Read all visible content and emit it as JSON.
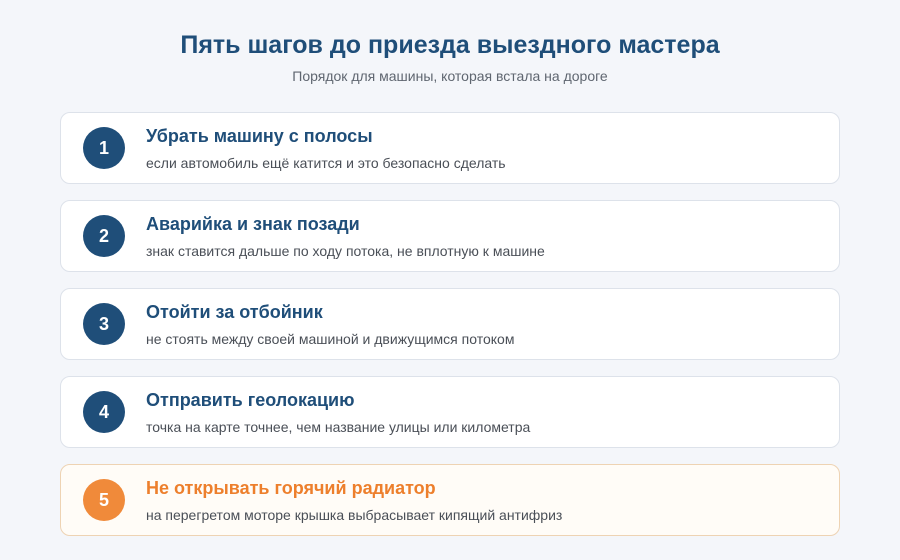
{
  "header": {
    "title": "Пять шагов до приезда выездного мастера",
    "subtitle": "Порядок для машины, которая встала на дороге"
  },
  "steps": [
    {
      "number": "1",
      "title": "Убрать машину с полосы",
      "description": "если автомобиль ещё катится и это безопасно сделать"
    },
    {
      "number": "2",
      "title": "Аварийка и знак позади",
      "description": "знак ставится дальше по ходу потока, не вплотную к машине"
    },
    {
      "number": "3",
      "title": "Отойти за отбойник",
      "description": "не стоять между своей машиной и движущимся потоком"
    },
    {
      "number": "4",
      "title": "Отправить геолокацию",
      "description": "точка на карте точнее, чем название улицы или километра"
    },
    {
      "number": "5",
      "title": "Не открывать горячий радиатор",
      "description": "на перегретом моторе крышка выбрасывает кипящий антифриз"
    }
  ],
  "colors": {
    "primary": "#1f4e79",
    "warning": "#f08a3a",
    "background": "#f4f6fa"
  }
}
